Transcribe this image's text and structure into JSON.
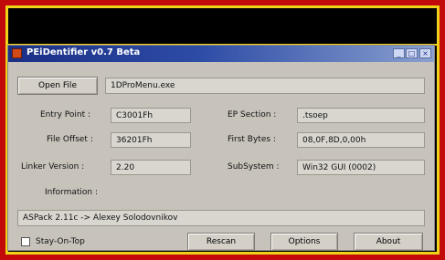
{
  "window": {
    "title": "PEiDentifier v0.7 Beta",
    "controls": {
      "minimize": "_",
      "maximize": "□",
      "close": "×"
    }
  },
  "toolbar": {
    "open_file_label": "Open File",
    "file_path": "1DProMenu.exe"
  },
  "fields": {
    "entry_point_label": "Entry Point :",
    "entry_point_value": "C3001Fh",
    "ep_section_label": "EP Section :",
    "ep_section_value": ".tsoep",
    "file_offset_label": "File Offset :",
    "file_offset_value": "36201Fh",
    "first_bytes_label": "First Bytes :",
    "first_bytes_value": "08,0F,8D,0,00h",
    "linker_version_label": "Linker Version :",
    "linker_version_value": "2.20",
    "subsystem_label": "SubSystem :",
    "subsystem_value": "Win32 GUI (0002)"
  },
  "information": {
    "label": "Information :",
    "value": "ASPack 2.11c -> Alexey Solodovnikov"
  },
  "footer": {
    "stay_on_top_label": "Stay-On-Top",
    "rescan_label": "Rescan",
    "options_label": "Options",
    "about_label": "About"
  }
}
